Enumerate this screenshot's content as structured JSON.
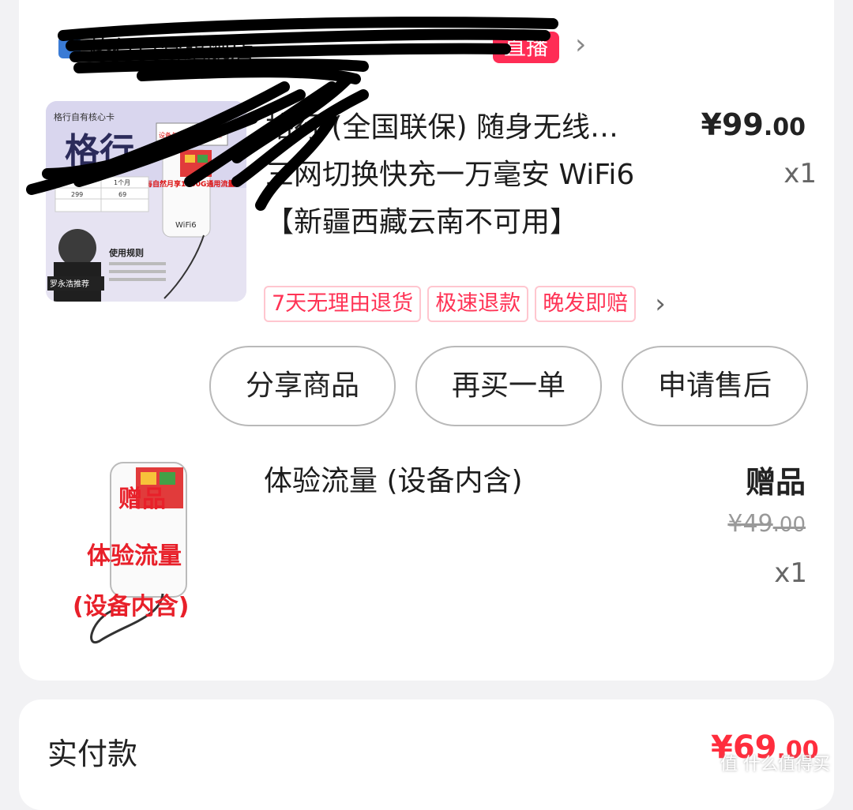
{
  "store": {
    "name": "格行自营旗舰店",
    "live_badge": "直播",
    "chevron": "›"
  },
  "product": {
    "title_line1": "格行 (全国联保) 随身无线…",
    "title_rest": "三网切换快充一万毫安 WiFi6【新疆西藏云南不可用】",
    "price_int": "¥99",
    "price_dec": ".00",
    "qty": "x1",
    "thumb": {
      "brand": "格行自有核心卡",
      "big_text": "格行",
      "badge": "设备与流量均全国联保",
      "banner": "每自然月享1500G通用流量",
      "table_head": [
        "1个月"
      ],
      "table_vals": [
        "299",
        "69"
      ],
      "rule_title": "使用规则",
      "presenter": "罗永浩推荐",
      "device_label": "WiFi6"
    },
    "tags": [
      "7天无理由退货",
      "极速退款",
      "晚发即赔"
    ],
    "tags_chevron": "›"
  },
  "buttons": {
    "share": "分享商品",
    "rebuy": "再买一单",
    "aftersale": "申请售后"
  },
  "gift": {
    "title": "体验流量 (设备内含)",
    "label": "赠品",
    "orig_int": "¥49",
    "orig_dec": ".00",
    "qty": "x1",
    "img_text": [
      "赠品",
      "体验流量",
      "(设备内含)"
    ]
  },
  "payment": {
    "label": "实付款",
    "amount_int": "¥69",
    "amount_dec": ".00"
  },
  "watermark": "值 什么值得买",
  "colors": {
    "accent": "#ff2d55",
    "price_red": "#ff2d3d",
    "tag_border": "#ffc6cf"
  }
}
